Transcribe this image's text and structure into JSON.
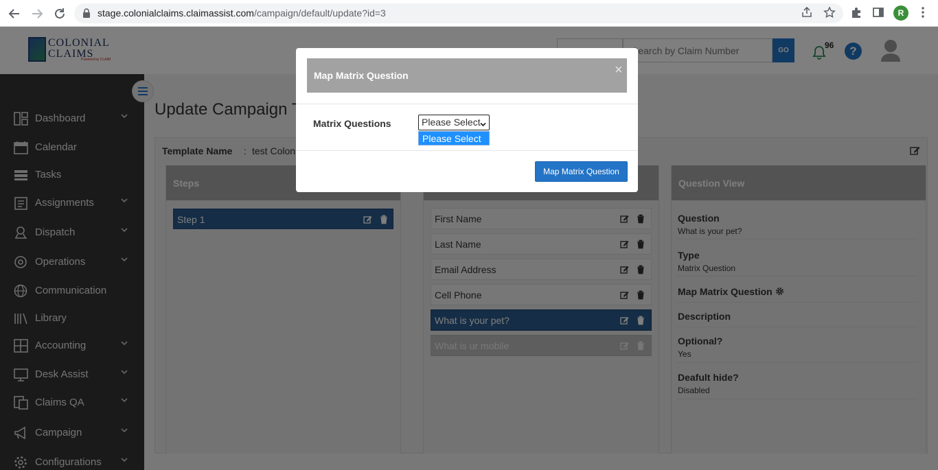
{
  "browser": {
    "url_host": "stage.colonialclaims.claimassist.com",
    "url_path": "/campaign/default/update?id=3",
    "profile_initial": "R"
  },
  "header": {
    "logo_line1": "COLONIAL",
    "logo_line2": "CLAIMS",
    "logo_sub": "Powered by CLAIM",
    "search_placeholder": "Search by Claim Number",
    "go_label": "GO",
    "notification_count": "96",
    "help_label": "?"
  },
  "sidebar": {
    "items": [
      {
        "label": "Dashboard",
        "icon": "dashboard-icon",
        "has_chevron": true
      },
      {
        "label": "Calendar",
        "icon": "calendar-icon",
        "has_chevron": false
      },
      {
        "label": "Tasks",
        "icon": "tasks-icon",
        "has_chevron": false
      },
      {
        "label": "Assignments",
        "icon": "assignments-icon",
        "has_chevron": true
      },
      {
        "label": "Dispatch",
        "icon": "dispatch-icon",
        "has_chevron": true
      },
      {
        "label": "Operations",
        "icon": "operations-icon",
        "has_chevron": true
      },
      {
        "label": "Communication",
        "icon": "globe-icon",
        "has_chevron": false
      },
      {
        "label": "Library",
        "icon": "library-icon",
        "has_chevron": false
      },
      {
        "label": "Accounting",
        "icon": "accounting-icon",
        "has_chevron": true
      },
      {
        "label": "Desk Assist",
        "icon": "desk-assist-icon",
        "has_chevron": true
      },
      {
        "label": "Claims QA",
        "icon": "claims-qa-icon",
        "has_chevron": true
      },
      {
        "label": "Campaign",
        "icon": "megaphone-icon",
        "has_chevron": true
      },
      {
        "label": "Configurations",
        "icon": "gear-icon",
        "has_chevron": true
      }
    ]
  },
  "main": {
    "title": "Update Campaign T",
    "template_label": "Template Name",
    "template_colon": ":",
    "template_value": "test Colon",
    "steps_header": "Steps",
    "steps": [
      "Step 1"
    ],
    "questions": [
      {
        "label": "First Name",
        "state": "normal"
      },
      {
        "label": "Last Name",
        "state": "normal"
      },
      {
        "label": "Email Address",
        "state": "normal"
      },
      {
        "label": "Cell Phone",
        "state": "normal"
      },
      {
        "label": "What is your pet?",
        "state": "active"
      },
      {
        "label": "What is ur mobile",
        "state": "disabled"
      }
    ],
    "question_view": {
      "header": "Question View",
      "question_label": "Question",
      "question_value": "What is your pet?",
      "type_label": "Type",
      "type_value": "Matrix Question",
      "map_label": "Map Matrix Question",
      "description_label": "Description",
      "optional_label": "Optional?",
      "optional_value": "Yes",
      "default_hide_label": "Deafult hide?",
      "default_hide_value": "Disabled"
    }
  },
  "modal": {
    "title": "Map Matrix Question",
    "close_label": "×",
    "field_label": "Matrix Questions",
    "select_value": "Please Select",
    "options": [
      "Please Select"
    ],
    "submit_label": "Map Matrix Question"
  },
  "colors": {
    "accent": "#2374c6",
    "active_row": "#2a5a8c",
    "sidebar_bg": "#343434",
    "header_gray": "#a7a7a7"
  }
}
